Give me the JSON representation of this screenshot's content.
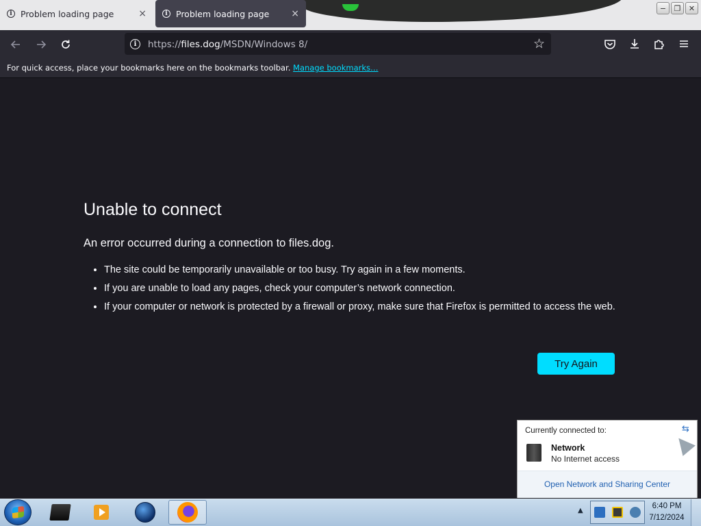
{
  "tabs": [
    {
      "title": "Problem loading page",
      "active": false
    },
    {
      "title": "Problem loading page",
      "active": true
    }
  ],
  "tab_close_glyph": "×",
  "window_controls": {
    "minimize": "−",
    "restore": "❐",
    "close": "✕"
  },
  "navigation": {
    "back_icon": "arrow-left-icon",
    "forward_icon": "arrow-right-icon",
    "reload_icon": "reload-icon",
    "url_prefix": "https://",
    "url_host": "files.dog",
    "url_path": "/MSDN/Windows 8/",
    "bookmark_icon": "star-icon",
    "toolbar_icons": [
      "pocket-icon",
      "download-icon",
      "extensions-icon",
      "menu-icon"
    ]
  },
  "bookmarks_bar": {
    "message": "For quick access, place your bookmarks here on the bookmarks toolbar.",
    "link": "Manage bookmarks…"
  },
  "error_page": {
    "title": "Unable to connect",
    "subtitle": "An error occurred during a connection to files.dog.",
    "bullets": [
      "The site could be temporarily unavailable or too busy. Try again in a few moments.",
      "If you are unable to load any pages, check your computer’s network connection.",
      "If your computer or network is protected by a firewall or proxy, make sure that Firefox is permitted to access the web."
    ],
    "button": "Try Again"
  },
  "network_popup": {
    "heading": "Currently connected to:",
    "network_name": "Network",
    "network_status": "No Internet access",
    "link": "Open Network and Sharing Center"
  },
  "taskbar": {
    "apps": [
      "explorer",
      "media-player",
      "globe-browser",
      "firefox"
    ],
    "active_app": "firefox",
    "time": "6:40 PM",
    "date": "7/12/2024"
  },
  "colors": {
    "page_bg": "#1c1b22",
    "toolbar_bg": "#2b2a33",
    "accent": "#00ddff",
    "text": "#fbfbfe"
  }
}
